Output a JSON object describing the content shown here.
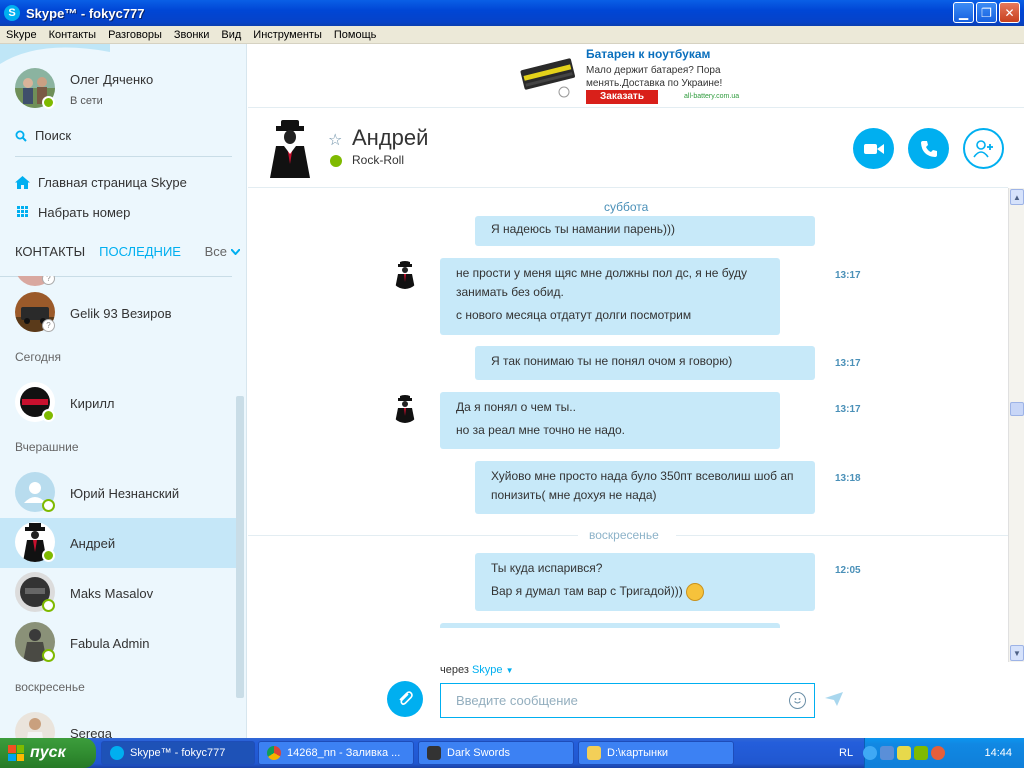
{
  "window": {
    "title": "Skype™ - fokyc777",
    "app_icon": "S"
  },
  "menu": [
    "Skype",
    "Контакты",
    "Разговоры",
    "Звонки",
    "Вид",
    "Инструменты",
    "Помощь"
  ],
  "profile": {
    "name": "Олег Дяченко",
    "status": "В сети"
  },
  "sidebar": {
    "search_label": "Поиск",
    "home_label": "Главная страница Skype",
    "dial_label": "Набрать номер",
    "tabs": {
      "contacts": "КОНТАКТЫ",
      "recent": "ПОСЛЕДНИЕ",
      "filter": "Все"
    },
    "groups": {
      "today": "Сегодня",
      "yesterday": "Вчерашние",
      "sunday": "воскресенье"
    },
    "contacts": {
      "gelik": "Gelik 93 Везиров",
      "kirill": "Кирилл",
      "yuriy": "Юрий Незнанский",
      "andrey": "Андрей",
      "maks": "Maks Masalov",
      "fabula": "Fabula Admin",
      "serega": "Serega"
    }
  },
  "ad": {
    "title": "Батарен к ноутбукам",
    "text": "Мало держит батарея? Пора менять.Доставка по Украине!",
    "button": "Заказать",
    "domain": "all-battery.com.ua"
  },
  "chat": {
    "contact_name": "Андрей",
    "mood": "Rock-Roll",
    "day_saturday": "суббота",
    "day_sunday": "воскресенье",
    "messages": {
      "m0": {
        "lines": [
          "Я надеюсь ты намании парень)))"
        ]
      },
      "m1": {
        "lines": [
          "не прости у меня щяс мне должны пол дс, я не буду занимать без обид.",
          "с нового месяца отдатут долги посмотрим"
        ],
        "time": "13:17"
      },
      "m2": {
        "lines": [
          "Я так понимаю ты не понял очом я говорю)"
        ],
        "time": "13:17"
      },
      "m3": {
        "lines": [
          "Да я понял о чем ты..",
          "но за реал мне точно не надо."
        ],
        "time": "13:17"
      },
      "m4": {
        "lines": [
          "Хуйово мне просто нада було 350пт всеволиш шоб ап понизить( мне дохуя не нада)"
        ],
        "time": "13:18"
      },
      "m5": {
        "lines": [
          "Ты куда испарився?",
          "Вар я думал там вар с Тригадой)))"
        ],
        "time": "12:05"
      }
    },
    "via_prefix": "через",
    "via_service": "Skype",
    "input_placeholder": "Введите сообщение"
  },
  "taskbar": {
    "start": "пуск",
    "tasks": [
      "Skype™ - fokyc777",
      "14268_nn - Заливка ...",
      "Dark Swords",
      "D:\\картынки"
    ],
    "lang": "RL",
    "clock": "14:44"
  },
  "colors": {
    "skype_blue": "#00aff0",
    "bubble": "#c7e9f9",
    "online": "#7fba00"
  }
}
